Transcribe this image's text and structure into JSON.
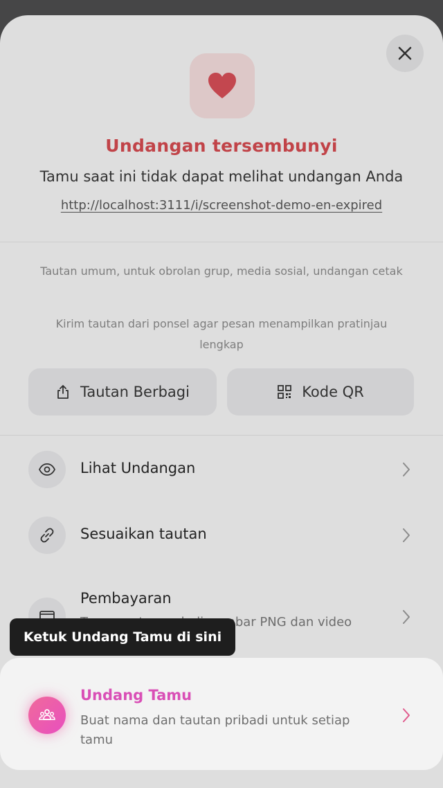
{
  "header": {
    "title": "Undangan tersembunyi",
    "subtitle": "Tamu saat ini tidak dapat melihat undangan Anda",
    "url": "http://localhost:3111/i/screenshot-demo-en-expired"
  },
  "info": {
    "line1": "Tautan umum, untuk obrolan grup, media sosial, undangan cetak",
    "line2": "Kirim tautan dari ponsel agar pesan menampilkan pratinjau lengkap"
  },
  "buttons": {
    "share_label": "Tautan Berbagi",
    "qr_label": "Kode QR"
  },
  "menu": {
    "view_label": "Lihat Undangan",
    "customize_label": "Sesuaikan tautan",
    "payment_label": "Pembayaran",
    "payment_sub": "Tanpa watermark di gambar PNG dan video"
  },
  "tooltip": {
    "text": "Ketuk Undang Tamu di sini"
  },
  "invite": {
    "title": "Undang Tamu",
    "subtitle": "Buat nama dan tautan pribadi untuk setiap tamu"
  },
  "colors": {
    "accent_red": "#d6474d",
    "accent_pink": "#d94fb6"
  }
}
